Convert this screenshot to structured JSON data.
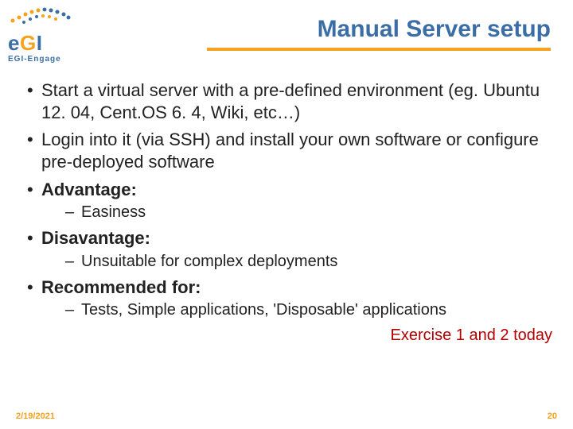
{
  "logo": {
    "brand_e": "e",
    "brand_g": "G",
    "brand_i": "I",
    "subtitle": "EGI-Engage"
  },
  "title": "Manual Server setup",
  "bullets": {
    "b1": "Start a virtual server with a pre-defined environment (eg. Ubuntu 12. 04, Cent.OS 6. 4, Wiki, etc…)",
    "b2": "Login into it (via SSH) and install your own software or configure pre-deployed software",
    "b3": "Advantage:",
    "b3s1": "Easiness",
    "b4": "Disavantage:",
    "b4s1": "Unsuitable for complex deployments",
    "b5": "Recommended for:",
    "b5s1": "Tests, Simple applications, 'Disposable' applications"
  },
  "note": "Exercise 1 and 2 today",
  "footer": {
    "date": "2/19/2021",
    "page": "20"
  }
}
